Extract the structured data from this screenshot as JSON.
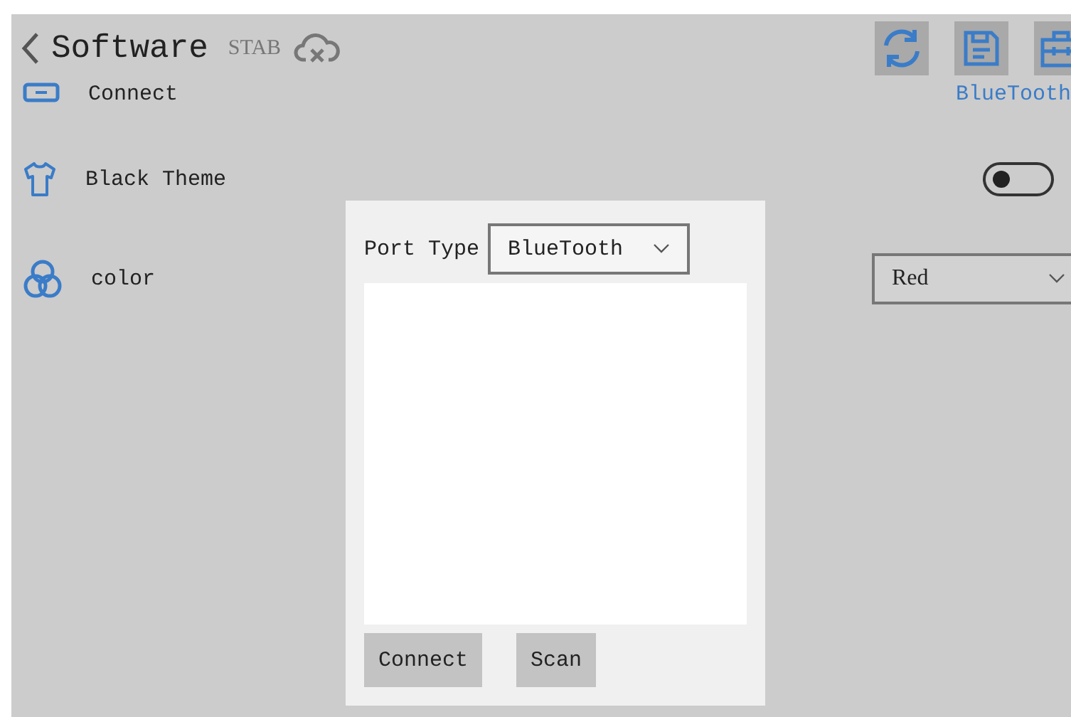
{
  "header": {
    "title": "Software",
    "subtitle": "STAB"
  },
  "settings": [
    {
      "kind": "value",
      "label": "Connect",
      "value": "BlueTooth"
    },
    {
      "kind": "toggle",
      "label": "Black Theme",
      "on": false
    },
    {
      "kind": "select",
      "label": "color",
      "value": "Red"
    }
  ],
  "dialog": {
    "port_type_label": "Port Type",
    "port_type": "BlueTooth",
    "buttons": [
      "Connect",
      "Scan"
    ]
  }
}
